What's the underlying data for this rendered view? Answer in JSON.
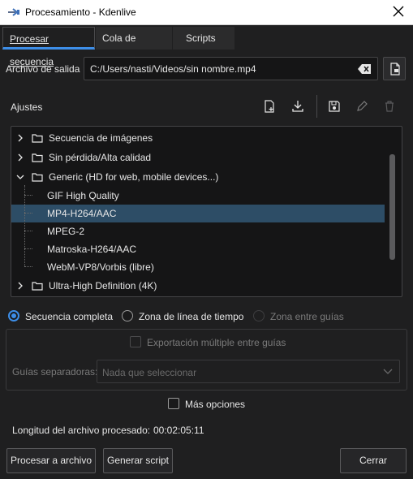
{
  "window": {
    "title": "Procesamiento - Kdenlive"
  },
  "tabs": [
    {
      "label": "Procesar secuencia",
      "active": true
    },
    {
      "label": "Cola de tareas",
      "active": false
    },
    {
      "label": "Scripts",
      "active": false
    }
  ],
  "output": {
    "label": "Archivo de salida",
    "value": "C:/Users/nasti/Videos/sin nombre.mp4"
  },
  "presets": {
    "label": "Ajustes",
    "items": [
      {
        "label": "Secuencia de imágenes",
        "type": "folder",
        "expanded": false
      },
      {
        "label": "Sin pérdida/Alta calidad",
        "type": "folder",
        "expanded": false
      },
      {
        "label": "Generic (HD for web, mobile devices...)",
        "type": "folder",
        "expanded": true
      },
      {
        "label": "GIF High Quality",
        "type": "preset"
      },
      {
        "label": "MP4-H264/AAC",
        "type": "preset",
        "selected": true
      },
      {
        "label": "MPEG-2",
        "type": "preset"
      },
      {
        "label": "Matroska-H264/AAC",
        "type": "preset"
      },
      {
        "label": "WebM-VP8/Vorbis (libre)",
        "type": "preset"
      },
      {
        "label": "Ultra-High Definition (4K)",
        "type": "folder",
        "expanded": false
      }
    ]
  },
  "range": {
    "full": "Secuencia completa",
    "timeline_zone": "Zona de línea de tiempo",
    "guide_zone": "Zona entre guías",
    "selected": "full"
  },
  "guides": {
    "multi_export": "Exportación múltiple entre guías",
    "separator_label": "Guías separadoras:",
    "separator_value": "Nada que seleccionar"
  },
  "more_options": "Más opciones",
  "duration": {
    "label": "Longitud del archivo procesado:",
    "value": "00:02:05:11"
  },
  "buttons": {
    "render": "Procesar a archivo",
    "script": "Generar script",
    "cancel": "Cerrar"
  },
  "colors": {
    "accent": "#3d8ee8",
    "selection": "#2d4d66",
    "background": "#1f1f20"
  }
}
